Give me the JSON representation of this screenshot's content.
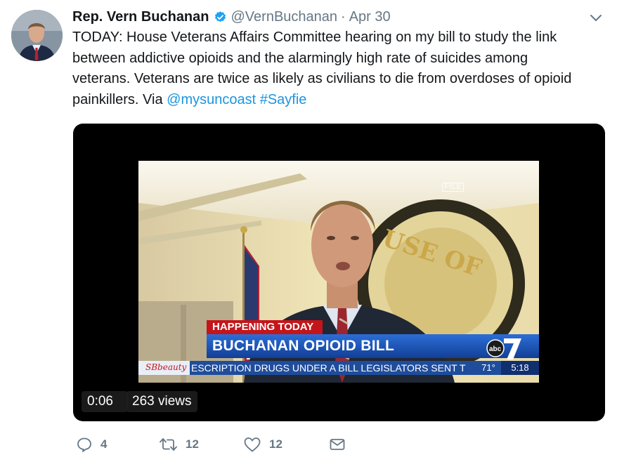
{
  "tweet": {
    "author_name": "Rep. Vern Buchanan",
    "handle": "@VernBuchanan",
    "separator": "·",
    "date": "Apr 30",
    "text_line1": "TODAY: House Veterans Affairs Committee hearing on my bill to study the link",
    "text_line2": "between addictive opioids and the alarmingly high rate of suicides among",
    "text_line3": "veterans. Veterans are twice as likely as civilians to die from overdoses of opioid",
    "text_line4_prefix": "painkillers. Via ",
    "mention": "@mysuncoast",
    "hashtag": "#Sayfie"
  },
  "video": {
    "elapsed": "0:06",
    "views": "263 views",
    "overlay": {
      "file_tag": "FILE",
      "happening": "HAPPENING TODAY",
      "headline": "BUCHANAN OPIOID BILL",
      "ticker": "ESCRIPTION DRUGS UNDER A BILL LEGISLATORS SENT T",
      "temperature": "71°",
      "time": "5:18",
      "station_logo": "SBbeauty",
      "network": "abc"
    }
  },
  "actions": {
    "reply_count": "4",
    "retweet_count": "12",
    "like_count": "12"
  },
  "icons": {
    "verified": "verified-badge-icon",
    "caret": "chevron-down-icon",
    "reply": "reply-icon",
    "retweet": "retweet-icon",
    "like": "heart-icon",
    "message": "envelope-icon"
  },
  "colors": {
    "link": "#1b95e0",
    "muted": "#657786",
    "text": "#14171a",
    "happening_red": "#c4151b",
    "headline_blue": "#1f4d9c"
  }
}
